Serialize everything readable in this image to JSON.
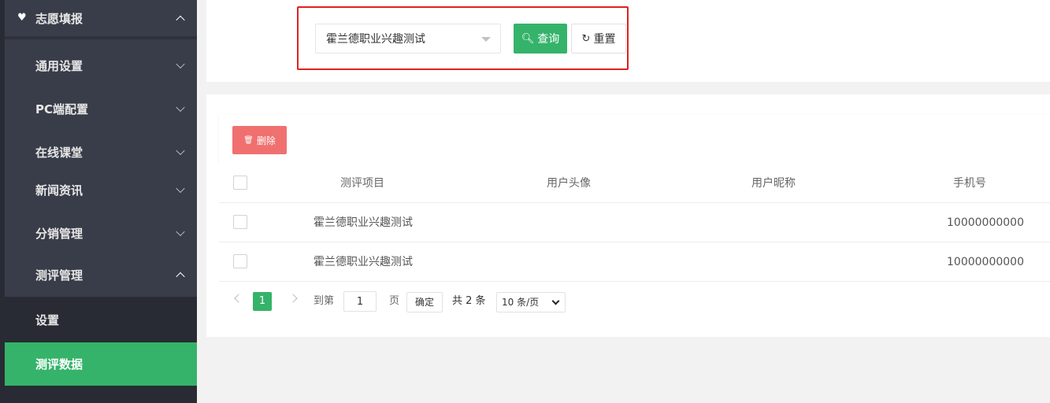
{
  "sidebar": {
    "top": {
      "label": "志愿填报",
      "icon": "heart-icon"
    },
    "items": [
      {
        "label": "通用设置"
      },
      {
        "label": "PC端配置"
      },
      {
        "label": "在线课堂"
      },
      {
        "label": "新闻资讯"
      },
      {
        "label": "分销管理"
      },
      {
        "label": "测评管理"
      }
    ],
    "children": [
      {
        "label": "设置"
      },
      {
        "label": "测评数据"
      }
    ]
  },
  "search": {
    "select_value": "霍兰德职业兴趣测试",
    "query_label": "查询",
    "reset_label": "重置"
  },
  "toolbar": {
    "delete_label": "删除"
  },
  "table": {
    "headers": {
      "project": "测评项目",
      "avatar": "用户头像",
      "nickname": "用户昵称",
      "phone": "手机号"
    },
    "rows": [
      {
        "project": "霍兰德职业兴趣测试",
        "avatar": "",
        "nickname": "",
        "phone": "10000000000"
      },
      {
        "project": "霍兰德职业兴趣测试",
        "avatar": "",
        "nickname": "",
        "phone": "10000000000"
      }
    ]
  },
  "pagination": {
    "current": "1",
    "goto_label": "到第",
    "goto_value": "1",
    "page_label": "页",
    "confirm_label": "确定",
    "total_label": "共 2 条",
    "page_size": "10 条/页"
  },
  "colors": {
    "accent": "#35b36a",
    "danger": "#f07070",
    "sidebar_bg": "#393d49",
    "highlight_border": "#e02020"
  }
}
